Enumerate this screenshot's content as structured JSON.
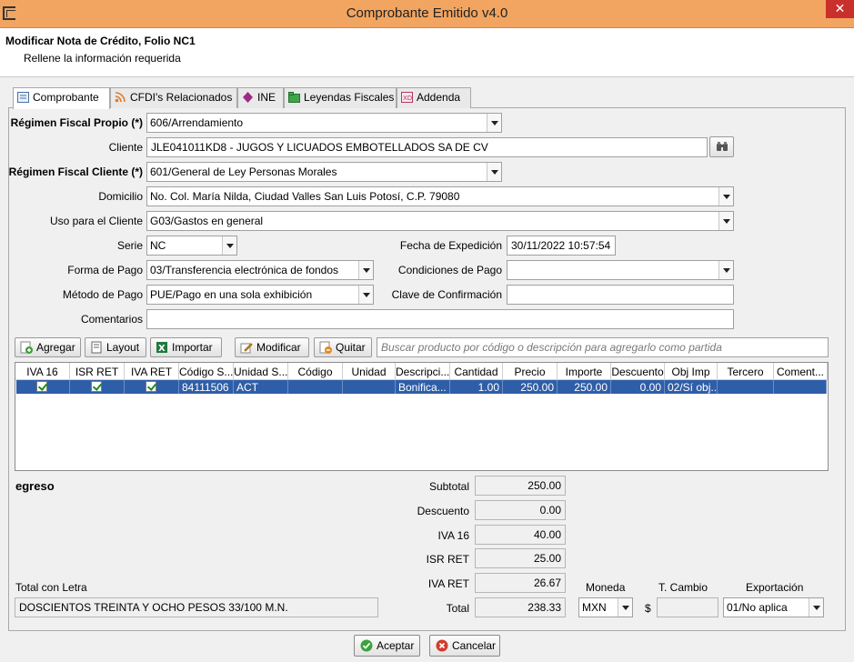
{
  "window": {
    "title": "Comprobante Emitido v4.0",
    "close_glyph": "✕"
  },
  "header": {
    "title": "Modificar Nota de Crédito, Folio NC1",
    "subtitle": "Rellene la información requerida"
  },
  "tabs": [
    {
      "label": "Comprobante",
      "icon": "document-icon"
    },
    {
      "label": "CFDI's Relacionados",
      "icon": "rss-icon"
    },
    {
      "label": "INE",
      "icon": "diamond-icon"
    },
    {
      "label": "Leyendas Fiscales",
      "icon": "folder-icon"
    },
    {
      "label": "Addenda",
      "icon": "addenda-icon"
    }
  ],
  "form": {
    "regimen_propio_label": "Régimen Fiscal Propio (*)",
    "regimen_propio_value": "606/Arrendamiento",
    "cliente_label": "Cliente",
    "cliente_value": "JLE041011KD8 - JUGOS Y LICUADOS EMBOTELLADOS SA DE CV",
    "regimen_cliente_label": "Régimen Fiscal Cliente (*)",
    "regimen_cliente_value": "601/General de Ley Personas Morales",
    "domicilio_label": "Domicilio",
    "domicilio_value": "No.  Col. María Nilda, Ciudad Valles San Luis Potosí, C.P. 79080",
    "uso_label": "Uso para el Cliente",
    "uso_value": "G03/Gastos en general",
    "serie_label": "Serie",
    "serie_value": "NC",
    "fecha_label": "Fecha de Expedición",
    "fecha_value": "30/11/2022 10:57:54",
    "forma_label": "Forma de Pago",
    "forma_value": "03/Transferencia electrónica de fondos",
    "condiciones_label": "Condiciones de Pago",
    "condiciones_value": "",
    "metodo_label": "Método de Pago",
    "metodo_value": "PUE/Pago en una sola exhibición",
    "clave_label": "Clave de Confirmación",
    "clave_value": "",
    "comentarios_label": "Comentarios",
    "comentarios_value": ""
  },
  "toolbar": {
    "agregar": "Agregar",
    "layout": "Layout",
    "importar": "Importar",
    "modificar": "Modificar",
    "quitar": "Quitar",
    "search_placeholder": "Buscar producto por código o descripción para agregarlo como partida"
  },
  "table": {
    "headers": [
      "IVA 16",
      "ISR RET",
      "IVA RET",
      "Código S...",
      "Unidad S...",
      "Código",
      "Unidad",
      "Descripci...",
      "Cantidad",
      "Precio",
      "Importe",
      "Descuento",
      "Obj Imp",
      "Tercero",
      "Coment..."
    ],
    "rows": [
      {
        "iva16": true,
        "isr_ret": true,
        "iva_ret": true,
        "codigo_sat": "84111506",
        "unidad_sat": "ACT",
        "codigo": "",
        "unidad": "",
        "descripcion": "Bonifica...",
        "cantidad": "1.00",
        "precio": "250.00",
        "importe": "250.00",
        "descuento": "0.00",
        "obj_imp": "02/Sí obj...",
        "tercero": "",
        "comentario": ""
      }
    ]
  },
  "totals": {
    "tipo": "egreso",
    "subtotal_label": "Subtotal",
    "subtotal": "250.00",
    "descuento_label": "Descuento",
    "descuento": "0.00",
    "iva16_label": "IVA 16",
    "iva16": "40.00",
    "isr_ret_label": "ISR RET",
    "isr_ret": "25.00",
    "iva_ret_label": "IVA RET",
    "iva_ret": "26.67",
    "total_label": "Total",
    "total": "238.33",
    "letra_label": "Total con Letra",
    "letra_value": "DOSCIENTOS TREINTA Y OCHO PESOS 33/100 M.N.",
    "moneda_label": "Moneda",
    "moneda_value": "MXN",
    "tcambio_label": "T. Cambio",
    "tcambio_symbol": "$",
    "tcambio_value": "",
    "exportacion_label": "Exportación",
    "exportacion_value": "01/No aplica"
  },
  "footer": {
    "aceptar": "Aceptar",
    "cancelar": "Cancelar"
  },
  "colors": {
    "titlebar": "#f2a560",
    "selection": "#2f5ea8",
    "close": "#c9302c"
  }
}
